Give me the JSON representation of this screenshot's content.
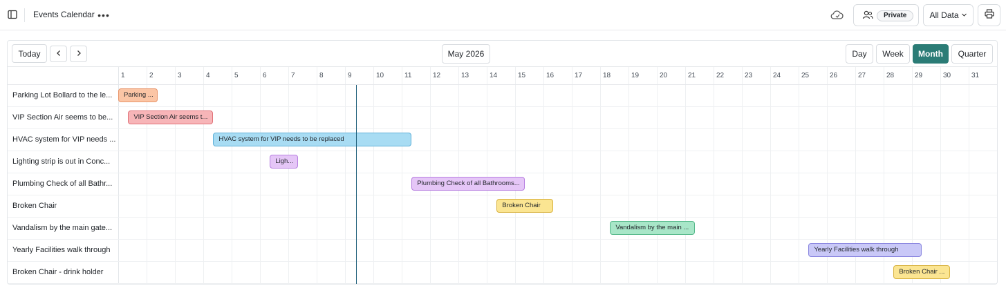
{
  "topbar": {
    "title": "Events Calendar",
    "more": "•••",
    "sharing": "Private",
    "filter": "All Data"
  },
  "toolbar": {
    "today": "Today",
    "month_label": "May 2026",
    "views": [
      "Day",
      "Week",
      "Month",
      "Quarter"
    ],
    "active_view": "Month"
  },
  "days": [
    "1",
    "2",
    "3",
    "4",
    "5",
    "6",
    "7",
    "8",
    "9",
    "10",
    "11",
    "12",
    "13",
    "14",
    "15",
    "16",
    "17",
    "18",
    "19",
    "20",
    "21",
    "22",
    "23",
    "24",
    "25",
    "26",
    "27",
    "28",
    "29",
    "30",
    "31"
  ],
  "rows": [
    {
      "label": "Parking Lot Bollard to the le...",
      "event": "Parking ...",
      "start_day": 1,
      "end_day": 2.4,
      "color": "#fbc5a5",
      "border": "#e8956a"
    },
    {
      "label": "VIP Section Air seems to be...",
      "event": "VIP Section Air seems t...",
      "start_day": 1.35,
      "end_day": 4.35,
      "color": "#f7b5b8",
      "border": "#e07077"
    },
    {
      "label": "HVAC system for VIP needs ...",
      "event": "HVAC system for VIP needs to be replaced",
      "start_day": 4.35,
      "end_day": 11.35,
      "color": "#a8dcf3",
      "border": "#5fb0d8"
    },
    {
      "label": "Lighting strip is out in Conc...",
      "event": "Ligh...",
      "start_day": 6.35,
      "end_day": 7.35,
      "color": "#e5c6f7",
      "border": "#b67ee0"
    },
    {
      "label": "Plumbing Check of all Bathr...",
      "event": "Plumbing Check of all Bathrooms...",
      "start_day": 11.35,
      "end_day": 15.35,
      "color": "#e5c6f7",
      "border": "#b67ee0"
    },
    {
      "label": "Broken Chair",
      "event": "Broken Chair",
      "start_day": 14.35,
      "end_day": 16.35,
      "color": "#fbe592",
      "border": "#d8b23f"
    },
    {
      "label": "Vandalism by the main gate...",
      "event": "Vandalism by the main ...",
      "start_day": 18.35,
      "end_day": 21.35,
      "color": "#a8e6c8",
      "border": "#55b88a"
    },
    {
      "label": "Yearly Facilities walk through",
      "event": "Yearly Facilities walk through",
      "start_day": 25.35,
      "end_day": 29.35,
      "color": "#c9c8f7",
      "border": "#8a86df"
    },
    {
      "label": "Broken Chair - drink holder",
      "event": "Broken Chair ...",
      "start_day": 28.35,
      "end_day": 30.35,
      "color": "#fbe592",
      "border": "#d8b23f"
    }
  ]
}
